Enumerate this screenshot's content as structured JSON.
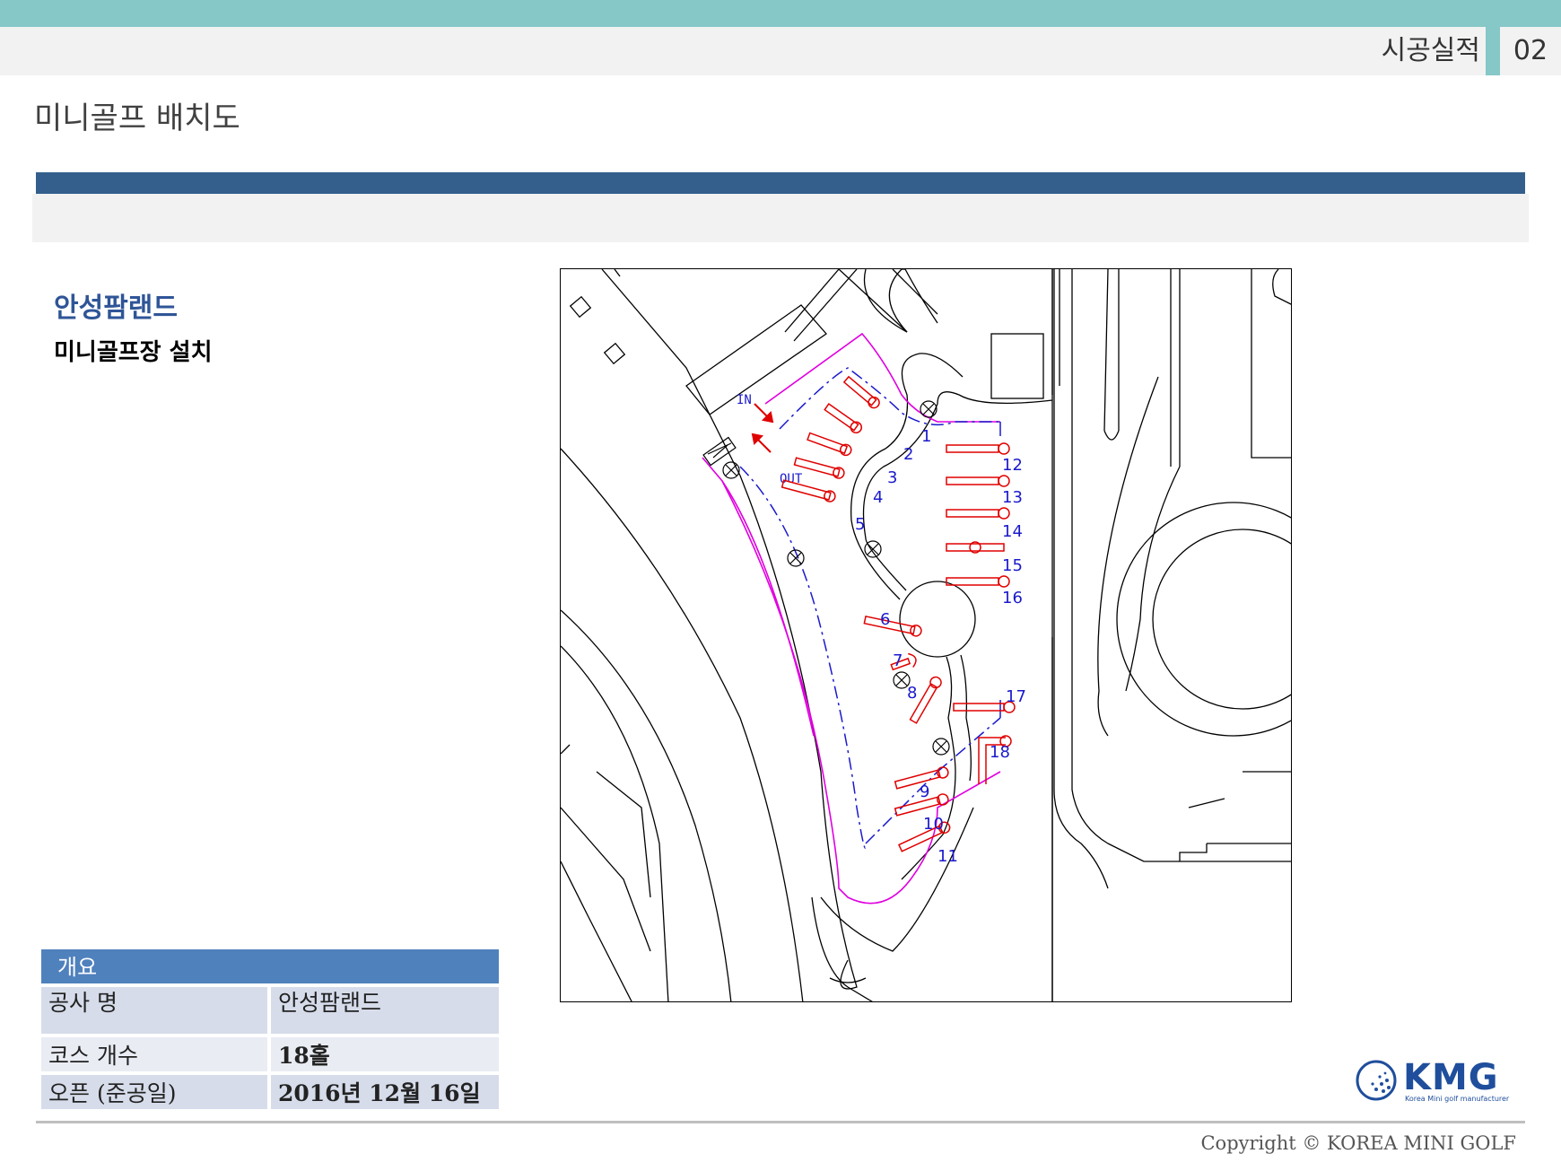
{
  "header": {
    "section_label": "시공실적",
    "page_number": "02"
  },
  "page_title": "미니골프 배치도",
  "project": {
    "name": "안성팜랜드",
    "description": "미니골프장 설치"
  },
  "drawing": {
    "entrance_label": "IN",
    "exit_label": "OUT",
    "hole_numbers": [
      "1",
      "2",
      "3",
      "4",
      "5",
      "6",
      "7",
      "8",
      "9",
      "10",
      "11",
      "12",
      "13",
      "14",
      "15",
      "16",
      "17",
      "18"
    ]
  },
  "summary": {
    "heading": "개요",
    "rows": [
      {
        "label": "공사 명",
        "value": "안성팜랜드"
      },
      {
        "label": "코스 개수",
        "value": "18홀"
      },
      {
        "label": "오픈 (준공일)",
        "value": "2016년 12월 16일"
      }
    ]
  },
  "logo": {
    "name": "KMG",
    "tagline": "Korea Mini golf manufacturer"
  },
  "footer": {
    "copyright": "Copyright © KOREA MINI GOLF"
  }
}
